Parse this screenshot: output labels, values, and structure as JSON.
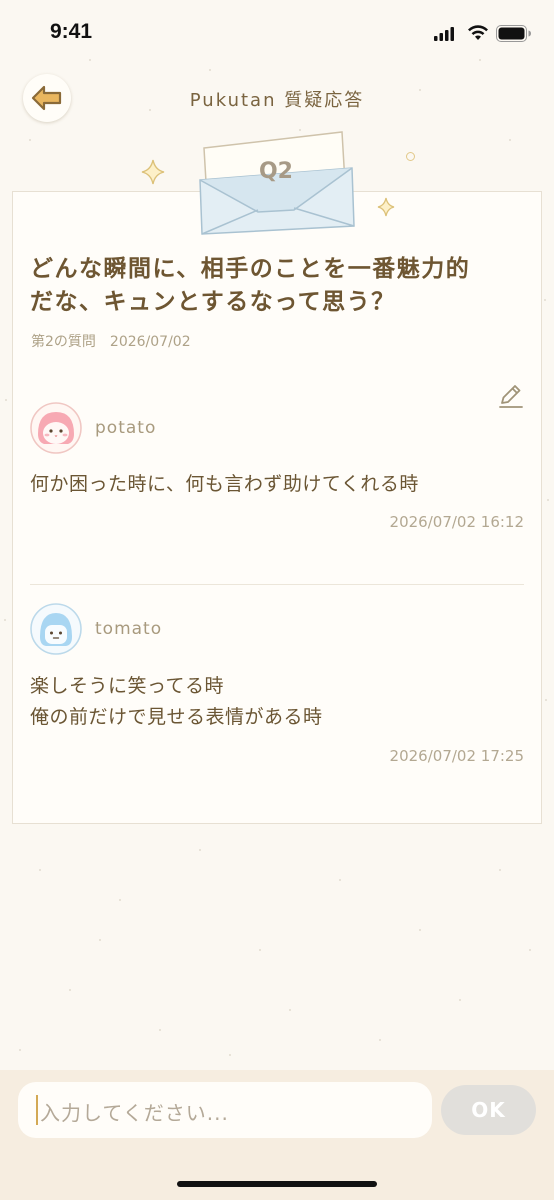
{
  "status_bar": {
    "time": "9:41"
  },
  "header": {
    "title": "Pukutan 質疑応答"
  },
  "question": {
    "badge": "Q2",
    "text": "どんな瞬間に、相手のことを一番魅力的\nだな、キュンとするなって思う？",
    "number_label": "第2の質問",
    "date": "2026/07/02"
  },
  "answers": [
    {
      "author": "potato",
      "text": "何か困った時に、何も言わず助けてくれる時",
      "timestamp": "2026/07/02  16:12",
      "avatar_color": "#f7a9b3"
    },
    {
      "author": "tomato",
      "text": "楽しそうに笑ってる時\n俺の前だけで見せる表情がある時",
      "timestamp": "2026/07/02  17:25",
      "avatar_color": "#a9d6f2"
    }
  ],
  "composer": {
    "placeholder": "入力してください...",
    "ok_label": "OK"
  },
  "colors": {
    "background": "#fbf8f2",
    "text_brown": "#6b5634",
    "input_bar": "#f6ede0",
    "ok_disabled": "#e1dfdb"
  }
}
